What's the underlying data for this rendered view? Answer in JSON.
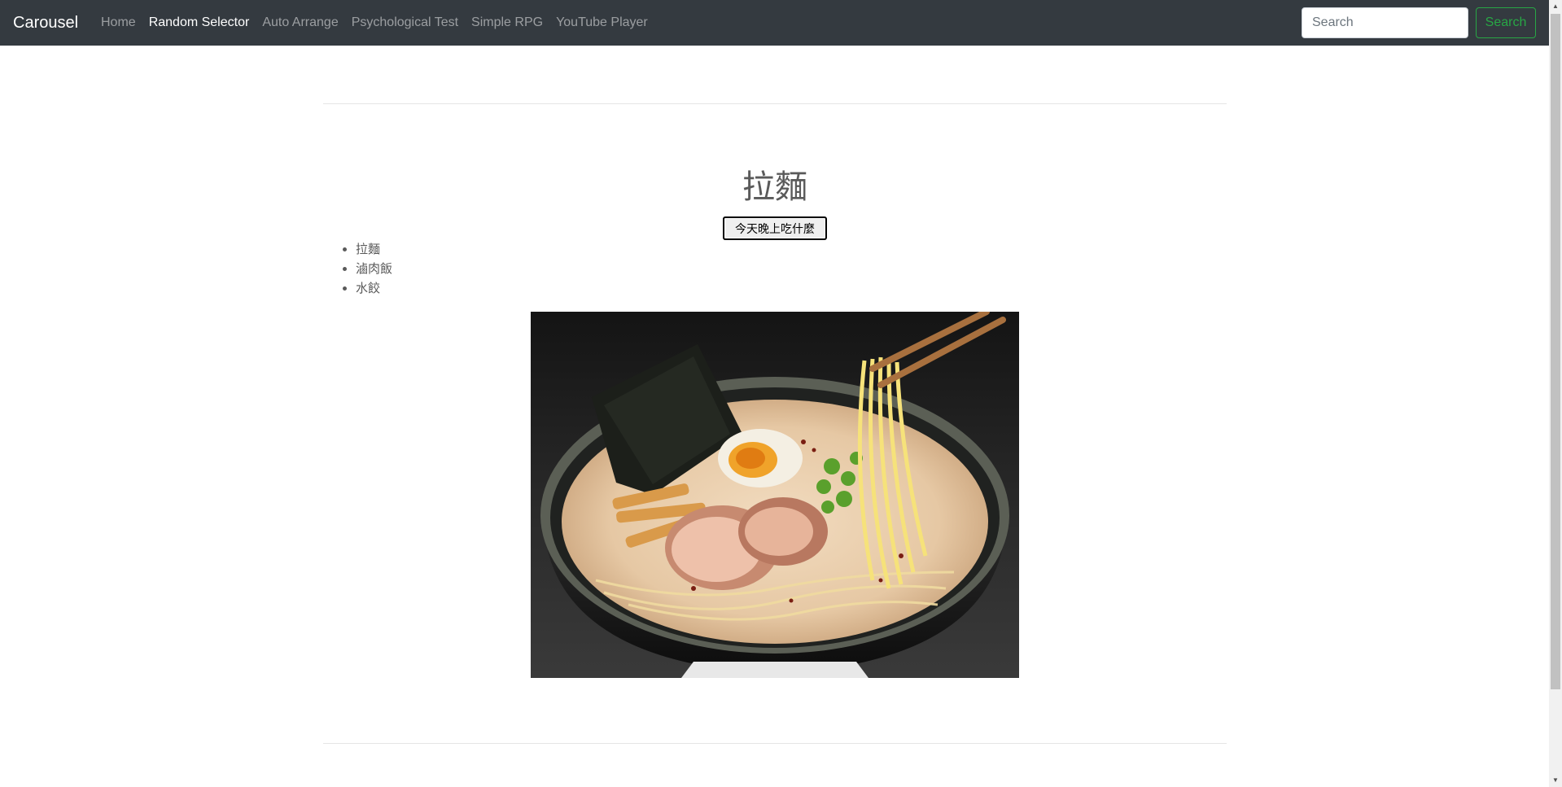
{
  "navbar": {
    "brand": "Carousel",
    "links": [
      {
        "label": "Home",
        "active": false
      },
      {
        "label": "Random Selector",
        "active": true
      },
      {
        "label": "Auto Arrange",
        "active": false
      },
      {
        "label": "Psychological Test",
        "active": false
      },
      {
        "label": "Simple RPG",
        "active": false
      },
      {
        "label": "YouTube Player",
        "active": false
      }
    ],
    "search": {
      "placeholder": "Search",
      "value": "",
      "button_label": "Search"
    }
  },
  "main": {
    "result": "拉麵",
    "pick_button_label": "今天晚上吃什麼",
    "options": [
      "拉麵",
      "滷肉飯",
      "水餃"
    ],
    "image_alt": "拉麵"
  },
  "colors": {
    "navbar_bg": "#343a40",
    "search_button": "#28a745",
    "heading_text": "#5a5a5a"
  }
}
